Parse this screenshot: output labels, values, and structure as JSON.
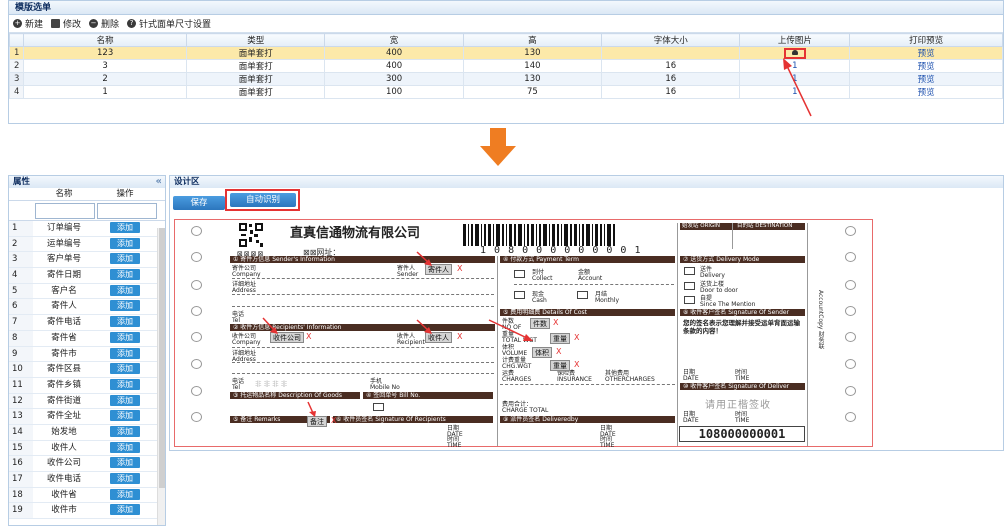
{
  "top": {
    "title": "模版选单",
    "toolbar": [
      {
        "label": "新建",
        "icon": "plus-icon"
      },
      {
        "label": "修改",
        "icon": "edit-icon"
      },
      {
        "label": "删除",
        "icon": "minus-icon"
      },
      {
        "label": "针式面单尺寸设置",
        "icon": "question-icon"
      }
    ],
    "columns": [
      "名称",
      "类型",
      "宽",
      "高",
      "字体大小",
      "上传图片",
      "打印预览"
    ],
    "rows": [
      {
        "n": "1",
        "name": "123",
        "type": "面单套打",
        "w": "400",
        "h": "130",
        "font": "",
        "upload": "",
        "preview": "预览"
      },
      {
        "n": "2",
        "name": "3",
        "type": "面单套打",
        "w": "400",
        "h": "140",
        "font": "16",
        "upload": "1",
        "preview": "预览"
      },
      {
        "n": "3",
        "name": "2",
        "type": "面单套打",
        "w": "300",
        "h": "130",
        "font": "16",
        "upload": "1",
        "preview": "预览"
      },
      {
        "n": "4",
        "name": "1",
        "type": "面单套打",
        "w": "100",
        "h": "75",
        "font": "16",
        "upload": "1",
        "preview": "预览"
      }
    ]
  },
  "left": {
    "title": "属性",
    "col_name": "名称",
    "col_op": "操作",
    "add_label": "添加",
    "items": [
      {
        "n": "1",
        "name": "订单编号"
      },
      {
        "n": "2",
        "name": "运单编号"
      },
      {
        "n": "3",
        "name": "客户单号"
      },
      {
        "n": "4",
        "name": "寄件日期"
      },
      {
        "n": "5",
        "name": "客户名"
      },
      {
        "n": "6",
        "name": "寄件人"
      },
      {
        "n": "7",
        "name": "寄件电话"
      },
      {
        "n": "8",
        "name": "寄件省"
      },
      {
        "n": "9",
        "name": "寄件市"
      },
      {
        "n": "10",
        "name": "寄件区县"
      },
      {
        "n": "11",
        "name": "寄件乡镇"
      },
      {
        "n": "12",
        "name": "寄件街道"
      },
      {
        "n": "13",
        "name": "寄件全址"
      },
      {
        "n": "14",
        "name": "始发地"
      },
      {
        "n": "15",
        "name": "收件人"
      },
      {
        "n": "16",
        "name": "收件公司"
      },
      {
        "n": "17",
        "name": "收件电话"
      },
      {
        "n": "18",
        "name": "收件省"
      },
      {
        "n": "19",
        "name": "收件市"
      }
    ]
  },
  "right": {
    "title": "设计区",
    "save_label": "保存",
    "auto_label": "自动识别"
  },
  "waybill": {
    "company": "直真信通物流有限公司",
    "website": "网址：",
    "barcode_number": "1 0 8 0 0 0 0 0 0 0 0 1",
    "bottom_number": "108000000001",
    "origin": "始发站 ORIGIN",
    "destination": "目的站 DESTINATION",
    "sender_hdr": "① 寄件方信息 Sender's Information",
    "payment_hdr": "④ 付款方式 Payment Term",
    "delivery_hdr": "⑦ 送货方式 Delivery Mode",
    "recipient_hdr": "② 收件方信息 Recipients' Information",
    "cost_hdr": "⑤ 费用明细费 Details Of Cost",
    "signature_hdr": "⑧ 收件客户签名 Signature Of Sender",
    "goods_hdr": "③ 托运物品名称 Description Of Goods",
    "billno_hdr": "④ 签回单号 Bill No.",
    "remarks_hdr": "⑤ 备注 Remarks",
    "sig_recipients_hdr": "⑥ 收件员签名 Signature Of Recipients",
    "delivered_hdr": "⑨ 派件员签名 Deliveredby",
    "deliver_hdr": "⑩ 收件客户签名 Signature Of Deliver",
    "lbl_company": "寄件公司\nCompany",
    "lbl_sender": "寄件人\nSender",
    "lbl_address": "详细地址\nAddress",
    "lbl_tel": "电话\nTel",
    "lbl_rcompany": "收件公司\nCompany",
    "lbl_recipient": "收件人\nRecipient",
    "lbl_raddress": "详细地址\nAddress",
    "lbl_rtel": "电话\nTel",
    "lbl_mobile": "手机\nMobile No",
    "phone_placeholder": "非 非 非 非",
    "collect": "到付\nCollect",
    "account": "金额\nAccount",
    "cash": "现金\nCash",
    "monthly": "月结\nMonthly",
    "no_of": "件数\nNO OF",
    "total_wgt": "重量\nTOTAL WGT",
    "volume": "体积\nVOLUME",
    "chg_wgt": "计费重量\nCHG.WGT",
    "charges": "运费\nCHARGES",
    "insurance": "保险费\nINSURANCE",
    "other_charges": "其他费用\nOTHERCHARGES",
    "charge_total": "费用合计：\nCHARGE TOTAL",
    "date": "日期\nDATE",
    "time": "时间\nTIME",
    "delivery": "送件\nDelivery",
    "door": "送货上楼\nDoor to door",
    "mention": "自提\nSince The Mention",
    "notice": "您的签名表示您理解并接受运单背面运输条款的内容！",
    "please_sign": "请用正楷签收",
    "side_text": "AccountCopy 财务联",
    "fields": {
      "sender": "寄件人",
      "rcompany": "收件公司",
      "recipient": "收件人",
      "count": "件数",
      "weight": "重量",
      "volume": "体积",
      "weight2": "重量",
      "remarks": "备注"
    },
    "x_mark": "X"
  },
  "colors": {
    "accent": "#2e8fd3",
    "highlight": "#e53333",
    "selected_row": "#fce9a9",
    "arrow": "#ef7d22",
    "form_header": "#4a2d22"
  }
}
